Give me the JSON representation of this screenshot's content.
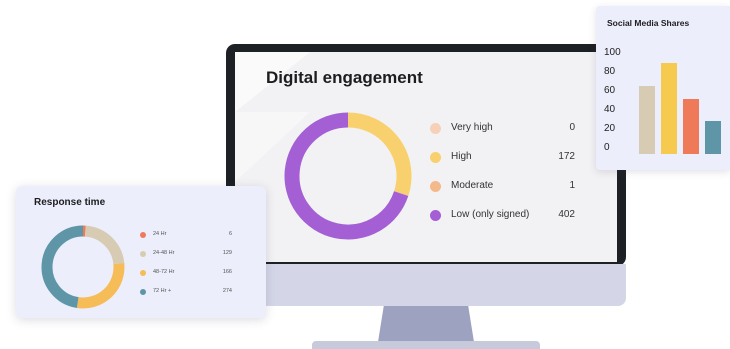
{
  "engagement": {
    "title": "Digital engagement",
    "items": [
      {
        "label": "Very high",
        "value": "0",
        "count": 0,
        "color": "#f6d1b7"
      },
      {
        "label": "High",
        "value": "172",
        "count": 172,
        "color": "#f8d16e"
      },
      {
        "label": "Moderate",
        "value": "1",
        "count": 1,
        "color": "#f4b98a"
      },
      {
        "label": "Low (only signed)",
        "value": "402",
        "count": 402,
        "color": "#a45fd4"
      }
    ]
  },
  "social": {
    "title": "Social Media Shares",
    "y_ticks": [
      "100",
      "80",
      "60",
      "40",
      "20",
      "0"
    ],
    "bars": [
      {
        "value": 72,
        "color": "#d7cbb3"
      },
      {
        "value": 97,
        "color": "#f6c94f"
      },
      {
        "value": 58,
        "color": "#ee7a5a"
      },
      {
        "value": 35,
        "color": "#5e96a8"
      }
    ]
  },
  "response": {
    "title": "Response time",
    "items": [
      {
        "label": "24 Hr",
        "value": "6",
        "count": 6,
        "color": "#ee7a5a"
      },
      {
        "label": "24-48 Hr",
        "value": "129",
        "count": 129,
        "color": "#d7cbb3"
      },
      {
        "label": "48-72 Hr",
        "value": "166",
        "count": 166,
        "color": "#f6bc57"
      },
      {
        "label": "72 Hr +",
        "value": "274",
        "count": 274,
        "color": "#5e96a8"
      }
    ]
  }
}
